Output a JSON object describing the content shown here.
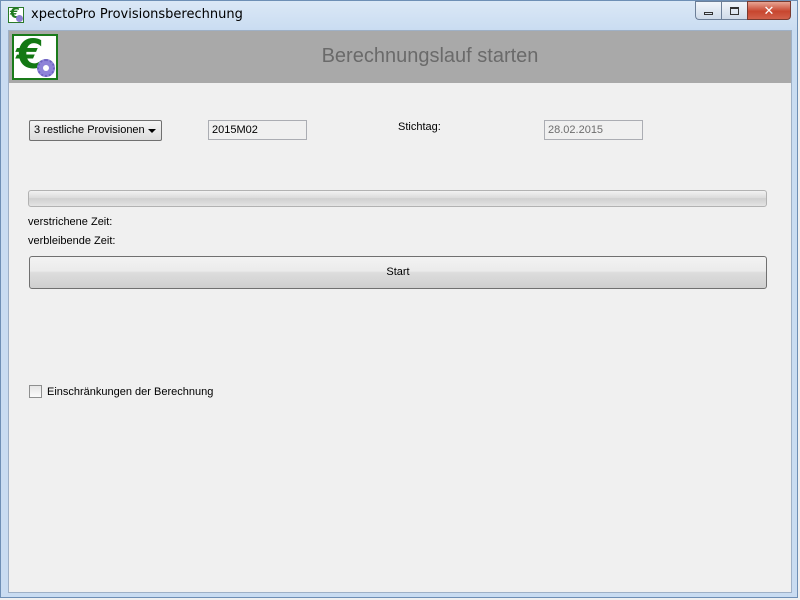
{
  "window": {
    "title": "xpectoPro Provisionsberechnung",
    "close_glyph": "✕"
  },
  "header": {
    "title": "Berechnungslauf starten"
  },
  "form": {
    "provision_select": {
      "selected": "3 restliche Provisionen"
    },
    "period_value": "2015M02",
    "stichtag_label": "Stichtag:",
    "stichtag_value": "28.02.2015"
  },
  "progress": {
    "value_percent": 0,
    "elapsed_label": "verstrichene Zeit:",
    "remaining_label": "verbleibende Zeit:"
  },
  "actions": {
    "start_label": "Start"
  },
  "options": {
    "restrictions_label": "Einschränkungen der Berechnung",
    "restrictions_checked": false
  },
  "icons": {
    "app": "euro-gear-icon",
    "logo": "euro-gear-logo"
  },
  "colors": {
    "header_bg": "#a9a9a9",
    "header_text": "#6a6a6a",
    "logo_green": "#137813",
    "gear_purple": "#8e83d8"
  }
}
